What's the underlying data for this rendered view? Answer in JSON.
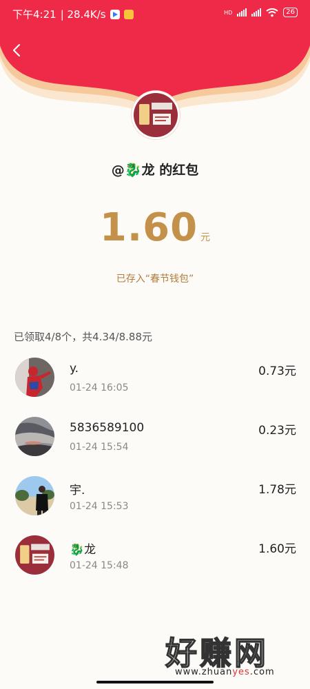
{
  "status_bar": {
    "time": "下午4:21",
    "speed": "| 28.4K/s",
    "network": "HD",
    "battery": "26"
  },
  "header": {
    "back_icon": "chevron-left-icon",
    "colors": {
      "red": "#ef2a49",
      "gold": "#f6c99d"
    }
  },
  "sender": {
    "prefix": "@",
    "emoji": "🐉",
    "name": "龙",
    "suffix": " 的红包"
  },
  "amount": {
    "value": "1.60",
    "unit": "元",
    "color": "#c4914a"
  },
  "deposit_note": "已存入“春节钱包”",
  "summary": "已领取4/8个，共4.34/8.88元",
  "recipients": [
    {
      "name": "y.",
      "time": "01-24 16:05",
      "amount": "0.73元",
      "avatar": "spiderman-avatar"
    },
    {
      "name": "5836589100",
      "time": "01-24 15:54",
      "amount": "0.23元",
      "avatar": "sky-avatar"
    },
    {
      "name": "宇.",
      "time": "01-24 15:53",
      "amount": "1.78元",
      "avatar": "person-avatar"
    },
    {
      "name": "龙",
      "emoji": "🐉",
      "time": "01-24 15:48",
      "amount": "1.60元",
      "avatar": "sign-avatar"
    }
  ],
  "watermark": {
    "title": "好赚网",
    "domain_a": "www.zhuan",
    "domain_b": "yes",
    "domain_c": ".com"
  }
}
